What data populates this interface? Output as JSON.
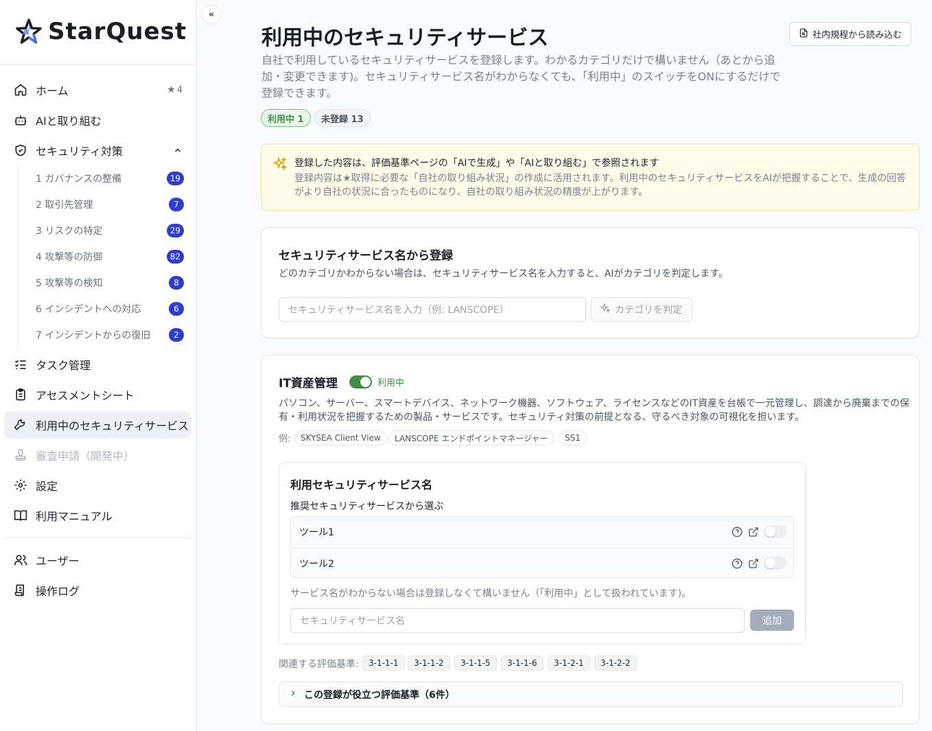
{
  "app": {
    "name": "StarQuest"
  },
  "sidebar": {
    "home": {
      "label": "ホーム",
      "star_count": "4"
    },
    "items": [
      {
        "label": "AIと取り組む"
      },
      {
        "label": "セキュリティ対策"
      }
    ],
    "sub_items": [
      {
        "label": "1 ガバナンスの整備",
        "count": "19"
      },
      {
        "label": "2 取引先管理",
        "count": "7"
      },
      {
        "label": "3 リスクの特定",
        "count": "29"
      },
      {
        "label": "4 攻撃等の防御",
        "count": "82"
      },
      {
        "label": "5 攻撃等の検知",
        "count": "8"
      },
      {
        "label": "6 インシデントへの対応",
        "count": "6"
      },
      {
        "label": "7 インシデントからの復旧",
        "count": "2"
      }
    ],
    "lower_items": [
      {
        "label": "タスク管理"
      },
      {
        "label": "アセスメントシート"
      },
      {
        "label": "利用中のセキュリティサービス"
      },
      {
        "label": "審査申請（開発中）"
      },
      {
        "label": "設定"
      },
      {
        "label": "利用マニュアル"
      }
    ],
    "admin_items": [
      {
        "label": "ユーザー"
      },
      {
        "label": "操作ログ"
      }
    ]
  },
  "header": {
    "title": "利用中のセキュリティサービス",
    "description": "自社で利用しているセキュリティサービスを登録します。わかるカテゴリだけで構いません（あとから追加・変更できます)。セキュリティサービス名がわからなくても、「利用中」のスイッチをONにするだけで登録できます。",
    "import_button": "社内規程から読み込む",
    "chip_in_use": "利用中 1",
    "chip_unregistered": "未登録 13"
  },
  "notice": {
    "title": "登録した内容は、評価基準ページの「AIで生成」や「AIと取り組む」で参照されます",
    "body": "登録内容は★取得に必要な「自社の取り組み状況」の作成に活用されます。利用中のセキュリティサービスをAIが把握することで、生成の回答がより自社の状況に合ったものになり、自社の取り組み状況の精度が上がります。"
  },
  "register_by_name": {
    "title": "セキュリティサービス名から登録",
    "subtitle": "どのカテゴリかわからない場合は、セキュリティサービス名を入力すると、AIがカテゴリを判定します。",
    "input_placeholder": "セキュリティサービス名を入力（例: LANSCOPE）",
    "judge_button": "カテゴリを判定"
  },
  "category": {
    "title": "IT資産管理",
    "status": "利用中",
    "toggle_on": true,
    "description": "パソコン、サーバー、スマートデバイス、ネットワーク機器、ソフトウェア、ライセンスなどのIT資産を台帳で一元管理し、調達から廃棄までの保有・利用状況を把握するための製品・サービスです。セキュリティ対策の前提となる、守るべき対象の可視化を担います。",
    "examples_label": "例:",
    "examples": [
      "SKYSEA Client View",
      "LANSCOPE エンドポイントマネージャー",
      "SS1"
    ],
    "services": {
      "title": "利用セキュリティサービス名",
      "recommended_label": "推奨セキュリティサービスから選ぶ",
      "tools": [
        {
          "name": "ツール1",
          "enabled": false
        },
        {
          "name": "ツール2",
          "enabled": false
        }
      ],
      "note": "サービス名がわからない場合は登録しなくて構いません（「利用中」として扱われています)。",
      "input_placeholder": "セキュリティサービス名",
      "add_button": "追加"
    },
    "related_label": "関連する評価基準:",
    "related": [
      "3-1-1-1",
      "3-1-1-2",
      "3-1-1-5",
      "3-1-1-6",
      "3-1-2-1",
      "3-1-2-2"
    ],
    "accordion_label": "この登録が役立つ評価基準（6件）"
  },
  "colors": {
    "accent_blue": "#2f3ec9",
    "success_green": "#3f8f43",
    "notice_bg": "#fefbe8"
  }
}
